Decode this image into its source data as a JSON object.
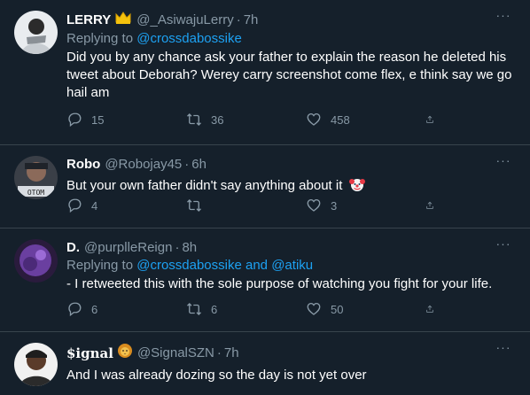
{
  "tweets": [
    {
      "display_name": "LERRY",
      "badge_icon": "crown-icon",
      "handle": "@_AsiwajuLerry",
      "dot": "·",
      "time": "7h",
      "replying_prefix": "Replying to",
      "replying_to": [
        "@crossdabossike"
      ],
      "replying_joiner": "",
      "text": "Did you by any chance ask your father to explain the reason he deleted his tweet about Deborah? Werey carry screenshot come flex, e think say we go hail am",
      "replies": "15",
      "retweets": "36",
      "likes": "458"
    },
    {
      "display_name": "Robo",
      "handle": "@Robojay45",
      "dot": "·",
      "time": "6h",
      "text": "But your own father didn't say anything about it",
      "emoji_icon": "clown-face-icon",
      "replies": "4",
      "retweets": "",
      "likes": "3"
    },
    {
      "display_name": "D.",
      "handle": "@purplleReign",
      "dot": "·",
      "time": "8h",
      "replying_prefix": "Replying to",
      "replying_to": [
        "@crossdabossike",
        "@atiku"
      ],
      "replying_joiner": "and",
      "text": "- I retweeted this with the sole purpose of watching you fight for your life.",
      "replies": "6",
      "retweets": "6",
      "likes": "50"
    },
    {
      "display_name": "$ignal",
      "badge_icon": "lion-face-icon",
      "handle": "@SignalSZN",
      "dot": "·",
      "time": "7h",
      "text": "And I was already dozing so the day is not yet over"
    }
  ],
  "more_label": "···",
  "colors": {
    "background": "#15202b",
    "secondary_text": "#8899a6",
    "link": "#1da1f2",
    "divider": "#38444d"
  }
}
